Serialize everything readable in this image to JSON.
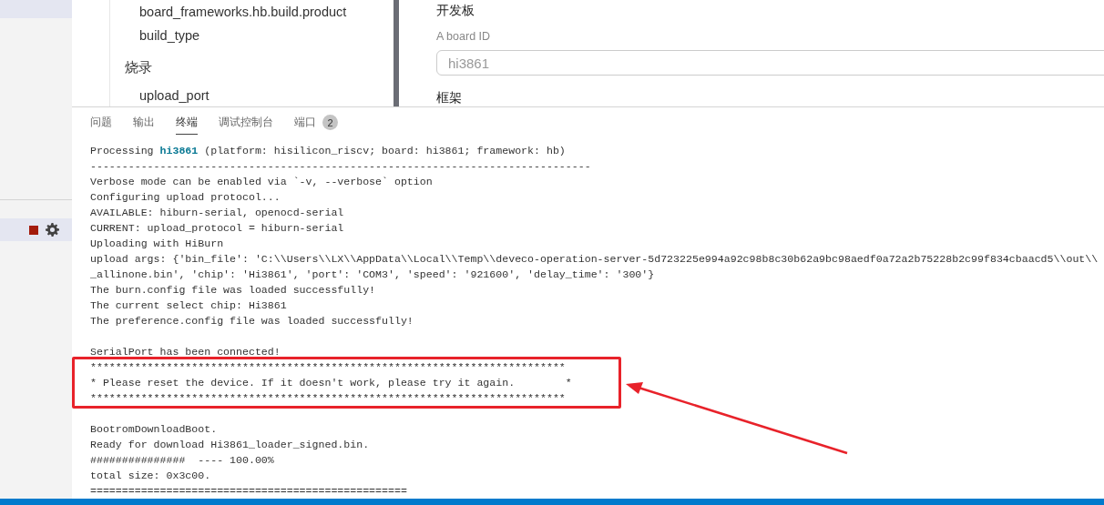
{
  "sidebar": {
    "items": [
      {
        "kind": "row",
        "selected": true
      },
      {
        "kind": "actions",
        "selected": true
      }
    ]
  },
  "config_tree": {
    "items": [
      {
        "kind": "leaf",
        "label": "board_frameworks.hb.build.product"
      },
      {
        "kind": "leaf",
        "label": "build_type"
      },
      {
        "kind": "group",
        "label": "烧录"
      },
      {
        "kind": "leaf",
        "label": "upload_port"
      }
    ]
  },
  "form": {
    "section": "开发板",
    "field_label": "A board ID",
    "field": {
      "placeholder": "hi3861"
    },
    "next_section": "框架"
  },
  "panel_tabs": [
    {
      "label": "问题",
      "selected": false
    },
    {
      "label": "输出",
      "selected": false
    },
    {
      "label": "终端",
      "selected": true
    },
    {
      "label": "调试控制台",
      "selected": false
    },
    {
      "label": "端口",
      "selected": false,
      "badge": "2"
    }
  ],
  "terminal": {
    "blocks": [
      {
        "kind": "text",
        "lines": [
          "Processing **hi3861** (platform: hisilicon_riscv; board: hi3861; framework: hb)",
          "-------------------------------------------------------------------------------",
          "Verbose mode can be enabled via `-v, --verbose` option",
          "Configuring upload protocol...",
          "AVAILABLE: hiburn-serial, openocd-serial",
          "CURRENT: upload_protocol = hiburn-serial",
          "Uploading with HiBurn",
          "upload args: {'bin_file': 'C:\\\\Users\\\\LX\\\\AppData\\\\Local\\\\Temp\\\\deveco-operation-server-5d723225e994a92c98b8c30b62a9bc98aedf0a72a2b75228b2c99f834cbaacd5\\\\out\\\\",
          "_allinone.bin', 'chip': 'Hi3861', 'port': 'COM3', 'speed': '921600', 'delay_time': '300'}",
          "The burn.config file was loaded successfully!",
          "The current select chip: Hi3861",
          "The preference.config file was loaded successfully!"
        ]
      },
      {
        "kind": "blank"
      },
      {
        "kind": "text",
        "lines": [
          "SerialPort has been connected!"
        ]
      },
      {
        "kind": "framed",
        "lines": [
          "***************************************************************************",
          "* Please reset the device. If it doesn't work, please try it again.        *",
          "***************************************************************************"
        ]
      },
      {
        "kind": "blank"
      },
      {
        "kind": "text",
        "lines": [
          "BootromDownloadBoot.",
          "Ready for download Hi3861_loader_signed.bin.",
          "###############  ---- 100.00%",
          "total size: 0x3c00.",
          "=================================================="
        ]
      }
    ]
  },
  "annotation": {
    "arrow": true
  }
}
